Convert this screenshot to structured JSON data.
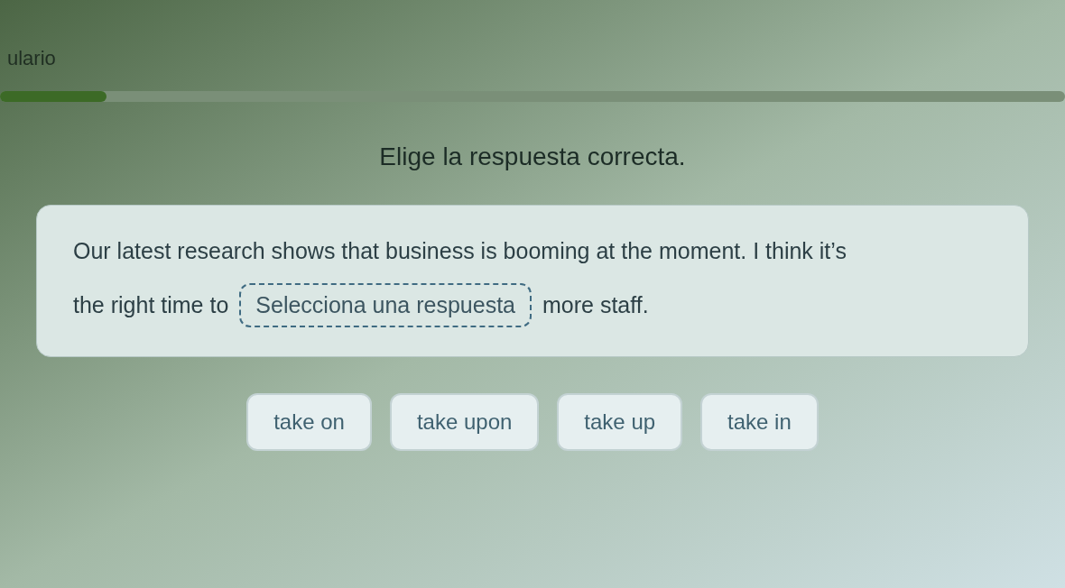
{
  "header": {
    "title": "ulario"
  },
  "progress": {
    "level": 0.1
  },
  "question": {
    "instruction": "Elige la respuesta correcta.",
    "sentence": {
      "line_1": "Our latest research shows that business is booming at the moment. I think it’s",
      "before_blank": "the right time to",
      "blank": {
        "placeholder": "Selecciona una respuesta"
      },
      "after_blank": "more staff."
    }
  },
  "options": [
    {
      "label": "take on"
    },
    {
      "label": "take upon"
    },
    {
      "label": "take up"
    },
    {
      "label": "take in"
    }
  ]
}
